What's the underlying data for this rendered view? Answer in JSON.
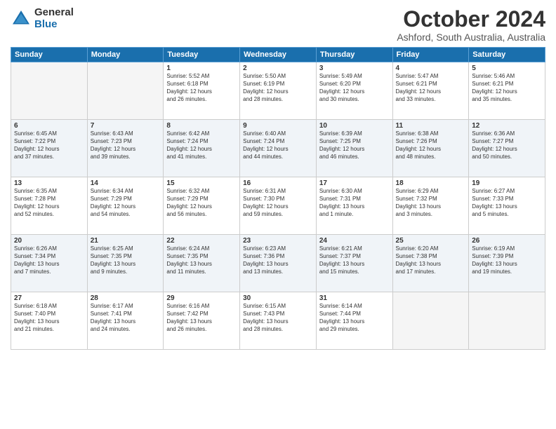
{
  "logo": {
    "general": "General",
    "blue": "Blue"
  },
  "title": "October 2024",
  "location": "Ashford, South Australia, Australia",
  "days_header": [
    "Sunday",
    "Monday",
    "Tuesday",
    "Wednesday",
    "Thursday",
    "Friday",
    "Saturday"
  ],
  "weeks": [
    {
      "shaded": false,
      "days": [
        {
          "num": "",
          "info": ""
        },
        {
          "num": "",
          "info": ""
        },
        {
          "num": "1",
          "info": "Sunrise: 5:52 AM\nSunset: 6:18 PM\nDaylight: 12 hours\nand 26 minutes."
        },
        {
          "num": "2",
          "info": "Sunrise: 5:50 AM\nSunset: 6:19 PM\nDaylight: 12 hours\nand 28 minutes."
        },
        {
          "num": "3",
          "info": "Sunrise: 5:49 AM\nSunset: 6:20 PM\nDaylight: 12 hours\nand 30 minutes."
        },
        {
          "num": "4",
          "info": "Sunrise: 5:47 AM\nSunset: 6:21 PM\nDaylight: 12 hours\nand 33 minutes."
        },
        {
          "num": "5",
          "info": "Sunrise: 5:46 AM\nSunset: 6:21 PM\nDaylight: 12 hours\nand 35 minutes."
        }
      ]
    },
    {
      "shaded": true,
      "days": [
        {
          "num": "6",
          "info": "Sunrise: 6:45 AM\nSunset: 7:22 PM\nDaylight: 12 hours\nand 37 minutes."
        },
        {
          "num": "7",
          "info": "Sunrise: 6:43 AM\nSunset: 7:23 PM\nDaylight: 12 hours\nand 39 minutes."
        },
        {
          "num": "8",
          "info": "Sunrise: 6:42 AM\nSunset: 7:24 PM\nDaylight: 12 hours\nand 41 minutes."
        },
        {
          "num": "9",
          "info": "Sunrise: 6:40 AM\nSunset: 7:24 PM\nDaylight: 12 hours\nand 44 minutes."
        },
        {
          "num": "10",
          "info": "Sunrise: 6:39 AM\nSunset: 7:25 PM\nDaylight: 12 hours\nand 46 minutes."
        },
        {
          "num": "11",
          "info": "Sunrise: 6:38 AM\nSunset: 7:26 PM\nDaylight: 12 hours\nand 48 minutes."
        },
        {
          "num": "12",
          "info": "Sunrise: 6:36 AM\nSunset: 7:27 PM\nDaylight: 12 hours\nand 50 minutes."
        }
      ]
    },
    {
      "shaded": false,
      "days": [
        {
          "num": "13",
          "info": "Sunrise: 6:35 AM\nSunset: 7:28 PM\nDaylight: 12 hours\nand 52 minutes."
        },
        {
          "num": "14",
          "info": "Sunrise: 6:34 AM\nSunset: 7:29 PM\nDaylight: 12 hours\nand 54 minutes."
        },
        {
          "num": "15",
          "info": "Sunrise: 6:32 AM\nSunset: 7:29 PM\nDaylight: 12 hours\nand 56 minutes."
        },
        {
          "num": "16",
          "info": "Sunrise: 6:31 AM\nSunset: 7:30 PM\nDaylight: 12 hours\nand 59 minutes."
        },
        {
          "num": "17",
          "info": "Sunrise: 6:30 AM\nSunset: 7:31 PM\nDaylight: 13 hours\nand 1 minute."
        },
        {
          "num": "18",
          "info": "Sunrise: 6:29 AM\nSunset: 7:32 PM\nDaylight: 13 hours\nand 3 minutes."
        },
        {
          "num": "19",
          "info": "Sunrise: 6:27 AM\nSunset: 7:33 PM\nDaylight: 13 hours\nand 5 minutes."
        }
      ]
    },
    {
      "shaded": true,
      "days": [
        {
          "num": "20",
          "info": "Sunrise: 6:26 AM\nSunset: 7:34 PM\nDaylight: 13 hours\nand 7 minutes."
        },
        {
          "num": "21",
          "info": "Sunrise: 6:25 AM\nSunset: 7:35 PM\nDaylight: 13 hours\nand 9 minutes."
        },
        {
          "num": "22",
          "info": "Sunrise: 6:24 AM\nSunset: 7:35 PM\nDaylight: 13 hours\nand 11 minutes."
        },
        {
          "num": "23",
          "info": "Sunrise: 6:23 AM\nSunset: 7:36 PM\nDaylight: 13 hours\nand 13 minutes."
        },
        {
          "num": "24",
          "info": "Sunrise: 6:21 AM\nSunset: 7:37 PM\nDaylight: 13 hours\nand 15 minutes."
        },
        {
          "num": "25",
          "info": "Sunrise: 6:20 AM\nSunset: 7:38 PM\nDaylight: 13 hours\nand 17 minutes."
        },
        {
          "num": "26",
          "info": "Sunrise: 6:19 AM\nSunset: 7:39 PM\nDaylight: 13 hours\nand 19 minutes."
        }
      ]
    },
    {
      "shaded": false,
      "days": [
        {
          "num": "27",
          "info": "Sunrise: 6:18 AM\nSunset: 7:40 PM\nDaylight: 13 hours\nand 21 minutes."
        },
        {
          "num": "28",
          "info": "Sunrise: 6:17 AM\nSunset: 7:41 PM\nDaylight: 13 hours\nand 24 minutes."
        },
        {
          "num": "29",
          "info": "Sunrise: 6:16 AM\nSunset: 7:42 PM\nDaylight: 13 hours\nand 26 minutes."
        },
        {
          "num": "30",
          "info": "Sunrise: 6:15 AM\nSunset: 7:43 PM\nDaylight: 13 hours\nand 28 minutes."
        },
        {
          "num": "31",
          "info": "Sunrise: 6:14 AM\nSunset: 7:44 PM\nDaylight: 13 hours\nand 29 minutes."
        },
        {
          "num": "",
          "info": ""
        },
        {
          "num": "",
          "info": ""
        }
      ]
    }
  ]
}
